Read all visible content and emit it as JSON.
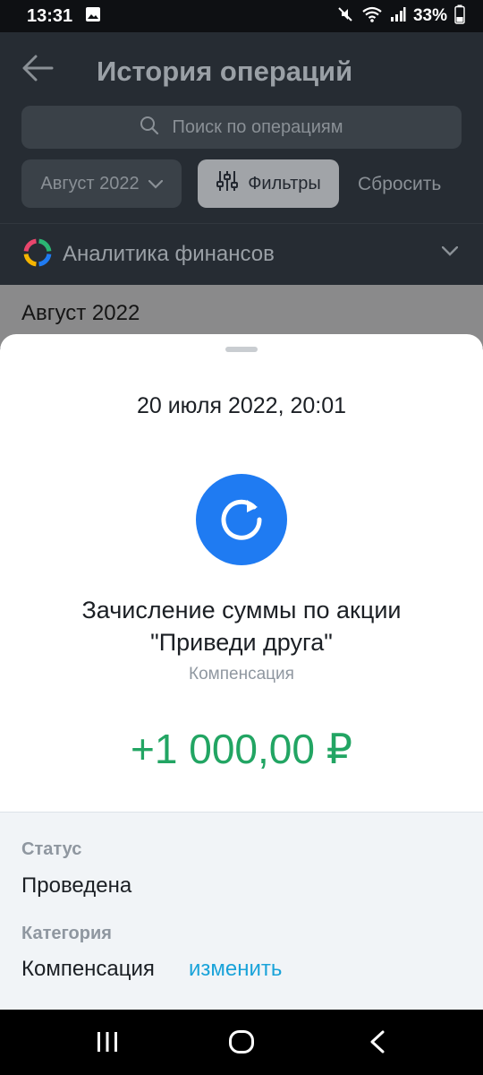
{
  "status_bar": {
    "time": "13:31",
    "battery": "33%",
    "icons": [
      "image-icon",
      "mute-icon",
      "wifi-icon",
      "signal-icon",
      "battery-icon"
    ]
  },
  "header": {
    "title": "История операций",
    "back_icon": "arrow-left-icon"
  },
  "search": {
    "placeholder": "Поиск по операциям",
    "icon": "search-icon"
  },
  "filters": {
    "month": "Август 2022",
    "filters_label": "Фильтры",
    "reset_label": "Сбросить"
  },
  "analytics": {
    "label": "Аналитика финансов",
    "ring_colors": [
      "#2bb673",
      "#1f7bf2",
      "#f4b400",
      "#e8466c"
    ]
  },
  "list": {
    "month_header": "Август 2022"
  },
  "operation": {
    "datetime": "20 июля 2022, 20:01",
    "icon": "refund-icon",
    "icon_color": "#1f7bf2",
    "title": "Зачисление суммы по акции \"Приведи друга\"",
    "category": "Компенсация",
    "amount": "+1 000,00 ₽",
    "amount_color": "#22a563"
  },
  "details": {
    "status_label": "Статус",
    "status_value": "Проведена",
    "category_label": "Категория",
    "category_value": "Компенсация",
    "category_edit": "изменить"
  },
  "navigation": {
    "buttons": [
      "recents-icon",
      "home-icon",
      "back-icon"
    ]
  }
}
